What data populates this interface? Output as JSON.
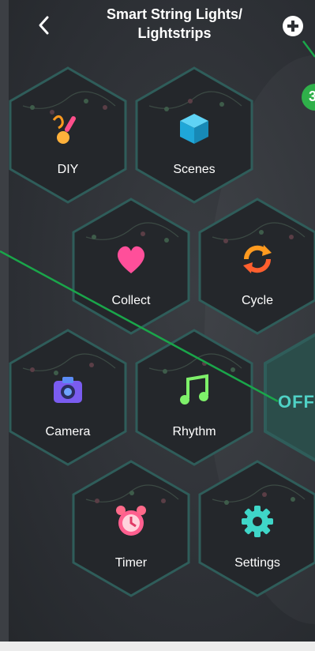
{
  "header": {
    "title_line1": "Smart String Lights/",
    "title_line2": "Lightstrips"
  },
  "tiles": [
    {
      "id": "diy",
      "label": "DIY",
      "icon": "paintbrush-icon"
    },
    {
      "id": "scenes",
      "label": "Scenes",
      "icon": "cube-icon"
    },
    {
      "id": "collect",
      "label": "Collect",
      "icon": "heart-icon"
    },
    {
      "id": "cycle",
      "label": "Cycle",
      "icon": "refresh-icon"
    },
    {
      "id": "camera",
      "label": "Camera",
      "icon": "camera-icon"
    },
    {
      "id": "rhythm",
      "label": "Rhythm",
      "icon": "music-note-icon"
    },
    {
      "id": "timer",
      "label": "Timer",
      "icon": "alarm-clock-icon"
    },
    {
      "id": "settings",
      "label": "Settings",
      "icon": "gear-icon"
    }
  ],
  "power": {
    "label": "OFF"
  },
  "badge": {
    "label": "3"
  },
  "colors": {
    "background": "#2b2e33",
    "hex_fill": "#24272b",
    "hex_border": "#2f5d5a",
    "off_text": "#4fd1c5",
    "annotation_line": "#1aa64a"
  }
}
